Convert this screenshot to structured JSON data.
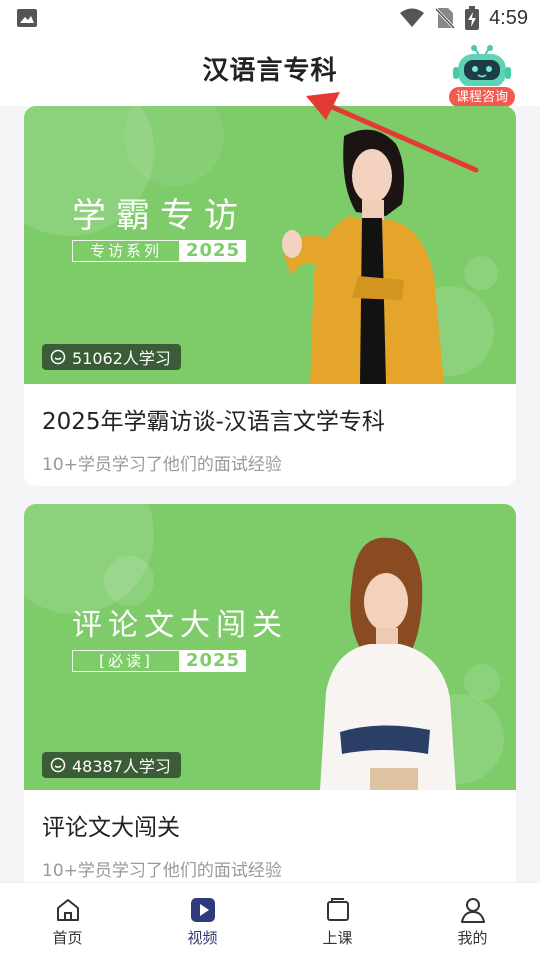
{
  "status": {
    "time": "4:59"
  },
  "header": {
    "title": "汉语言专科",
    "consult_label": "课程咨询"
  },
  "cards": [
    {
      "banner_title": "学霸专访",
      "banner_sub": "专访系列",
      "banner_year": "2025",
      "views": "51062人学习",
      "title": "2025年学霸访谈-汉语言文学专科",
      "desc": "10+学员学习了他们的面试经验"
    },
    {
      "banner_title": "评论文大闯关",
      "banner_sub": "[必读]",
      "banner_year": "2025",
      "views": "48387人学习",
      "title": "评论文大闯关",
      "desc": "10+学员学习了他们的面试经验"
    }
  ],
  "tabbar": {
    "items": [
      {
        "label": "首页",
        "icon": "home-icon"
      },
      {
        "label": "视频",
        "icon": "video-icon",
        "active": true
      },
      {
        "label": "上课",
        "icon": "class-icon"
      },
      {
        "label": "我的",
        "icon": "profile-icon"
      }
    ]
  },
  "colors": {
    "banner_green": "#7dcb69",
    "active_tab": "#2e3a7a",
    "consult_red": "#f25a50",
    "arrow_red": "#e53935"
  }
}
